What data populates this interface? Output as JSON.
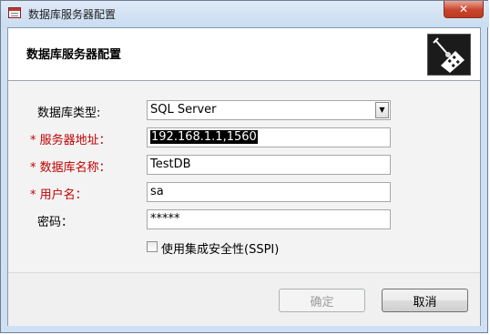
{
  "window": {
    "title": "数据库服务器配置",
    "close_label": "✕"
  },
  "header": {
    "title": "数据库服务器配置"
  },
  "form": {
    "db_type": {
      "label": "数据库类型:",
      "value": "SQL Server"
    },
    "server": {
      "required_mark": "*",
      "label": "服务器地址：",
      "value": "192.168.1.1,1560"
    },
    "db_name": {
      "required_mark": "*",
      "label": "数据库名称：",
      "value": "TestDB"
    },
    "user": {
      "required_mark": "*",
      "label": "用户名：",
      "value": "sa"
    },
    "password": {
      "label": "密码：",
      "value": "*****"
    },
    "sspi": {
      "label": "使用集成安全性(SSPI)",
      "checked": false
    }
  },
  "buttons": {
    "ok": "确定",
    "cancel": "取消"
  },
  "colors": {
    "required": "#c00000",
    "close_button": "#c7452c",
    "window_frame": "#cfe0f3"
  }
}
